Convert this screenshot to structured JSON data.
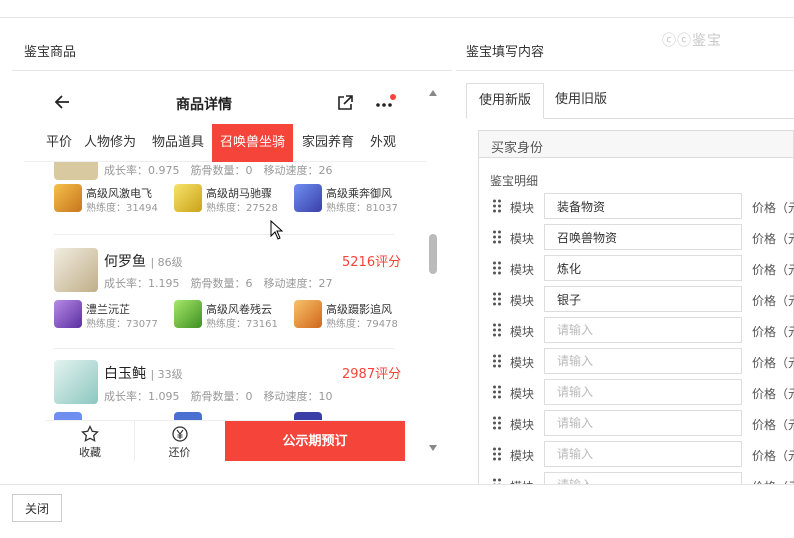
{
  "left_title": "鉴宝商品",
  "right_title": "鉴宝填写内容",
  "watermark": "ⓒⓒ鉴宝",
  "phone": {
    "title": "商品详情",
    "tabs": [
      "平价",
      "人物修为",
      "物品道具",
      "召唤兽坐骑",
      "家园养育",
      "外观"
    ],
    "active_tab": "召唤兽坐骑",
    "pets": [
      {
        "stats": "成长率：0.975　筋骨数量：0　移动速度：26",
        "skills": [
          {
            "name": "高级风激电飞",
            "xp": "熟练度：31494"
          },
          {
            "name": "高级胡马驰骤",
            "xp": "熟练度：27528"
          },
          {
            "name": "高级乘奔御风",
            "xp": "熟练度：81037"
          }
        ]
      },
      {
        "name": "何罗鱼",
        "level": "| 86级",
        "score": "5216评分",
        "stats": "成长率：1.195　筋骨数量：6　移动速度：27",
        "skills": [
          {
            "name": "澧兰沅芷",
            "xp": "熟练度：73077"
          },
          {
            "name": "高级风卷残云",
            "xp": "熟练度：73161"
          },
          {
            "name": "高级蹑影追风",
            "xp": "熟练度：79478"
          }
        ]
      },
      {
        "name": "白玉鲀",
        "level": "| 33级",
        "score": "2987评分",
        "stats": "成长率：1.095　筋骨数量：0　移动速度：10"
      }
    ],
    "bottom": {
      "fav": "收藏",
      "bargain": "还价",
      "preorder": "公示期预订"
    }
  },
  "right": {
    "tabs": [
      "使用新版",
      "使用旧版"
    ],
    "buyer": "买家身份",
    "detail": "鉴宝明细",
    "module_label": "模块",
    "price_label": "价格（元）",
    "placeholder": "请输入",
    "rows": [
      "装备物资",
      "召唤兽物资",
      "炼化",
      "银子",
      "",
      "",
      "",
      "",
      "",
      ""
    ]
  },
  "footer": {
    "close": "关闭"
  },
  "colors": {
    "accent": "#f5443a"
  }
}
